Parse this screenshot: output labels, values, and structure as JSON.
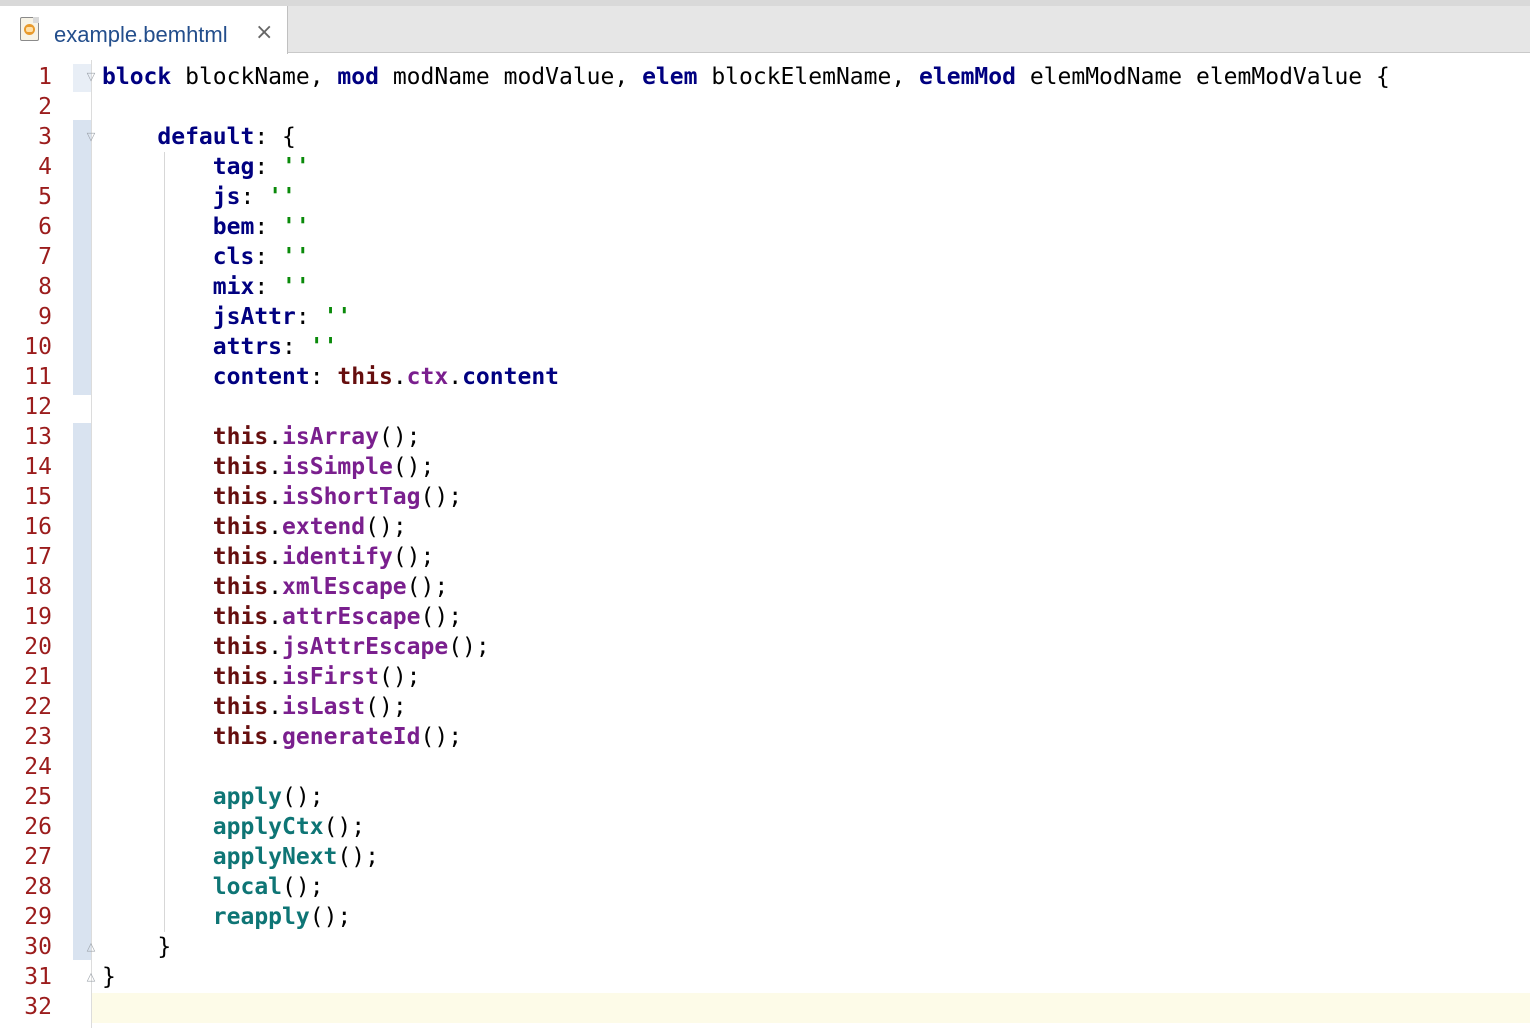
{
  "tab": {
    "filename": "example.bemhtml",
    "close": "×"
  },
  "lines": [
    [
      {
        "t": "kw",
        "v": "block"
      },
      {
        "t": "p",
        "v": " blockName, "
      },
      {
        "t": "kw",
        "v": "mod"
      },
      {
        "t": "p",
        "v": " modName modValue, "
      },
      {
        "t": "kw",
        "v": "elem"
      },
      {
        "t": "p",
        "v": " blockElemName, "
      },
      {
        "t": "kw",
        "v": "elemMod"
      },
      {
        "t": "p",
        "v": " elemModName elemModValue {"
      }
    ],
    [],
    [
      {
        "t": "p",
        "v": "    "
      },
      {
        "t": "kw",
        "v": "default"
      },
      {
        "t": "p",
        "v": ": {"
      }
    ],
    [
      {
        "t": "p",
        "v": "        "
      },
      {
        "t": "kw",
        "v": "tag"
      },
      {
        "t": "p",
        "v": ": "
      },
      {
        "t": "st",
        "v": "''"
      }
    ],
    [
      {
        "t": "p",
        "v": "        "
      },
      {
        "t": "kw",
        "v": "js"
      },
      {
        "t": "p",
        "v": ": "
      },
      {
        "t": "st",
        "v": "''"
      }
    ],
    [
      {
        "t": "p",
        "v": "        "
      },
      {
        "t": "kw",
        "v": "bem"
      },
      {
        "t": "p",
        "v": ": "
      },
      {
        "t": "st",
        "v": "''"
      }
    ],
    [
      {
        "t": "p",
        "v": "        "
      },
      {
        "t": "kw",
        "v": "cls"
      },
      {
        "t": "p",
        "v": ": "
      },
      {
        "t": "st",
        "v": "''"
      }
    ],
    [
      {
        "t": "p",
        "v": "        "
      },
      {
        "t": "kw",
        "v": "mix"
      },
      {
        "t": "p",
        "v": ": "
      },
      {
        "t": "st",
        "v": "''"
      }
    ],
    [
      {
        "t": "p",
        "v": "        "
      },
      {
        "t": "kw",
        "v": "jsAttr"
      },
      {
        "t": "p",
        "v": ": "
      },
      {
        "t": "st",
        "v": "''"
      }
    ],
    [
      {
        "t": "p",
        "v": "        "
      },
      {
        "t": "kw",
        "v": "attrs"
      },
      {
        "t": "p",
        "v": ": "
      },
      {
        "t": "st",
        "v": "''"
      }
    ],
    [
      {
        "t": "p",
        "v": "        "
      },
      {
        "t": "kw",
        "v": "content"
      },
      {
        "t": "p",
        "v": ": "
      },
      {
        "t": "th",
        "v": "this"
      },
      {
        "t": "p",
        "v": "."
      },
      {
        "t": "fn",
        "v": "ctx"
      },
      {
        "t": "p",
        "v": "."
      },
      {
        "t": "kw",
        "v": "content"
      }
    ],
    [],
    [
      {
        "t": "p",
        "v": "        "
      },
      {
        "t": "th",
        "v": "this"
      },
      {
        "t": "p",
        "v": "."
      },
      {
        "t": "fn",
        "v": "isArray"
      },
      {
        "t": "p",
        "v": "();"
      }
    ],
    [
      {
        "t": "p",
        "v": "        "
      },
      {
        "t": "th",
        "v": "this"
      },
      {
        "t": "p",
        "v": "."
      },
      {
        "t": "fn",
        "v": "isSimple"
      },
      {
        "t": "p",
        "v": "();"
      }
    ],
    [
      {
        "t": "p",
        "v": "        "
      },
      {
        "t": "th",
        "v": "this"
      },
      {
        "t": "p",
        "v": "."
      },
      {
        "t": "fn",
        "v": "isShortTag"
      },
      {
        "t": "p",
        "v": "();"
      }
    ],
    [
      {
        "t": "p",
        "v": "        "
      },
      {
        "t": "th",
        "v": "this"
      },
      {
        "t": "p",
        "v": "."
      },
      {
        "t": "fn",
        "v": "extend"
      },
      {
        "t": "p",
        "v": "();"
      }
    ],
    [
      {
        "t": "p",
        "v": "        "
      },
      {
        "t": "th",
        "v": "this"
      },
      {
        "t": "p",
        "v": "."
      },
      {
        "t": "fn",
        "v": "identify"
      },
      {
        "t": "p",
        "v": "();"
      }
    ],
    [
      {
        "t": "p",
        "v": "        "
      },
      {
        "t": "th",
        "v": "this"
      },
      {
        "t": "p",
        "v": "."
      },
      {
        "t": "fn",
        "v": "xmlEscape"
      },
      {
        "t": "p",
        "v": "();"
      }
    ],
    [
      {
        "t": "p",
        "v": "        "
      },
      {
        "t": "th",
        "v": "this"
      },
      {
        "t": "p",
        "v": "."
      },
      {
        "t": "fn",
        "v": "attrEscape"
      },
      {
        "t": "p",
        "v": "();"
      }
    ],
    [
      {
        "t": "p",
        "v": "        "
      },
      {
        "t": "th",
        "v": "this"
      },
      {
        "t": "p",
        "v": "."
      },
      {
        "t": "fn",
        "v": "jsAttrEscape"
      },
      {
        "t": "p",
        "v": "();"
      }
    ],
    [
      {
        "t": "p",
        "v": "        "
      },
      {
        "t": "th",
        "v": "this"
      },
      {
        "t": "p",
        "v": "."
      },
      {
        "t": "fn",
        "v": "isFirst"
      },
      {
        "t": "p",
        "v": "();"
      }
    ],
    [
      {
        "t": "p",
        "v": "        "
      },
      {
        "t": "th",
        "v": "this"
      },
      {
        "t": "p",
        "v": "."
      },
      {
        "t": "fn",
        "v": "isLast"
      },
      {
        "t": "p",
        "v": "();"
      }
    ],
    [
      {
        "t": "p",
        "v": "        "
      },
      {
        "t": "th",
        "v": "this"
      },
      {
        "t": "p",
        "v": "."
      },
      {
        "t": "fn",
        "v": "generateId"
      },
      {
        "t": "p",
        "v": "();"
      }
    ],
    [],
    [
      {
        "t": "p",
        "v": "        "
      },
      {
        "t": "ap",
        "v": "apply"
      },
      {
        "t": "p",
        "v": "();"
      }
    ],
    [
      {
        "t": "p",
        "v": "        "
      },
      {
        "t": "ap",
        "v": "applyCtx"
      },
      {
        "t": "p",
        "v": "();"
      }
    ],
    [
      {
        "t": "p",
        "v": "        "
      },
      {
        "t": "ap",
        "v": "applyNext"
      },
      {
        "t": "p",
        "v": "();"
      }
    ],
    [
      {
        "t": "p",
        "v": "        "
      },
      {
        "t": "ap",
        "v": "local"
      },
      {
        "t": "p",
        "v": "();"
      }
    ],
    [
      {
        "t": "p",
        "v": "        "
      },
      {
        "t": "ap",
        "v": "reapply"
      },
      {
        "t": "p",
        "v": "();"
      }
    ],
    [
      {
        "t": "p",
        "v": "    }"
      }
    ],
    [
      {
        "t": "p",
        "v": "}"
      }
    ],
    []
  ],
  "colors": {
    "keyword": "#000080",
    "this": "#660e0e",
    "method": "#7a1f8e",
    "apply": "#0e7575",
    "string": "#0a8a0a",
    "line_number": "#9b1c1c",
    "caret_line": "#fdfbe8"
  }
}
